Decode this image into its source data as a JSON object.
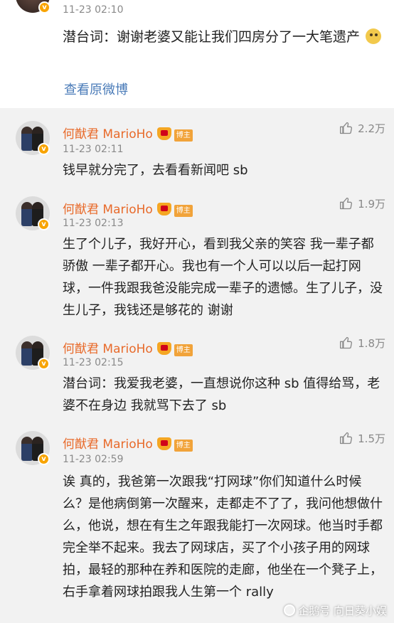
{
  "top_card": {
    "time": "11-23 02:10",
    "text": "潜台词：谢谢老婆又能让我们四房分了一大笔遗产",
    "emoji_icon": "doge-emoji",
    "view_original": "查看原微博"
  },
  "comments": [
    {
      "user": "何猷君 MarioHo",
      "badge": "博主",
      "time": "11-23 02:11",
      "likes": "2.2万",
      "text": "钱早就分完了，去看看新闻吧 sb"
    },
    {
      "user": "何猷君 MarioHo",
      "badge": "博主",
      "time": "11-23 02:13",
      "likes": "1.9万",
      "text": "生了个儿子，我好开心，看到我父亲的笑容 我一辈子都骄傲 一辈子都开心。我也有一个人可以以后一起打网球，一件我跟我爸没能完成一辈子的遗憾。生了儿子，没生儿子，我钱还是够花的 谢谢"
    },
    {
      "user": "何猷君 MarioHo",
      "badge": "博主",
      "time": "11-23 02:15",
      "likes": "1.8万",
      "text": "潜台词：我爱我老婆，一直想说你这种 sb 值得给骂，老婆不在身边 我就骂下去了 sb"
    },
    {
      "user": "何猷君 MarioHo",
      "badge": "博主",
      "time": "11-23 02:59",
      "likes": "1.5万",
      "text": "诶 真的，我爸第一次跟我“打网球”你们知道什么时候么？是他病倒第一次醒来，走都走不了了，我问他想做什么，他说，想在有生之年跟我能打一次网球。他当时手都完全举不起来。我去了网球店，买了个小孩子用的网球拍，最轻的那种在养和医院的走廊，他坐在一个凳子上，右手拿着网球拍跟我人生第一个 rally"
    }
  ],
  "watermark": "企鹅号 向日葵小娱",
  "colors": {
    "username": "#e86a2a",
    "link": "#4a7bb8",
    "background": "#f2f2f2",
    "verified_badge": "#f8a400"
  }
}
